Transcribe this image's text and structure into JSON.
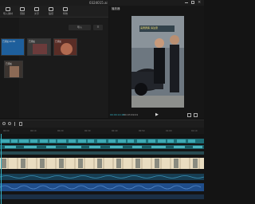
{
  "window": {
    "title": "0324015.ai"
  },
  "toolbar": {
    "items": [
      {
        "label": "导入素材",
        "icon": "import-icon"
      },
      {
        "label": "音频",
        "icon": "audio-icon"
      },
      {
        "label": "文字",
        "icon": "text-icon"
      },
      {
        "label": "贴纸",
        "icon": "sticker-icon"
      },
      {
        "label": "特效",
        "icon": "effects-icon"
      }
    ]
  },
  "media": {
    "filter_labels": [
      "导入",
      "☰"
    ],
    "thumbs": [
      {
        "caption": "已添加 00:58"
      },
      {
        "caption": "已添加"
      },
      {
        "caption": "已添加"
      },
      {
        "caption": "已添加"
      }
    ]
  },
  "preview": {
    "title": "播放器",
    "time_current": "00:00:14:28",
    "time_total": "00:03:49:01",
    "overlay_text": "来宾宾客 请注意"
  },
  "ruler": {
    "ticks": [
      "00:00",
      "00:10",
      "00:20",
      "00:30",
      "00:40",
      "00:50",
      "01:00",
      "01:10"
    ]
  },
  "colors": {
    "accent": "#35b7c9",
    "track_text": "#1d6d76",
    "track_video": "#e9dcc0",
    "track_audio": "#1f4d8a"
  }
}
